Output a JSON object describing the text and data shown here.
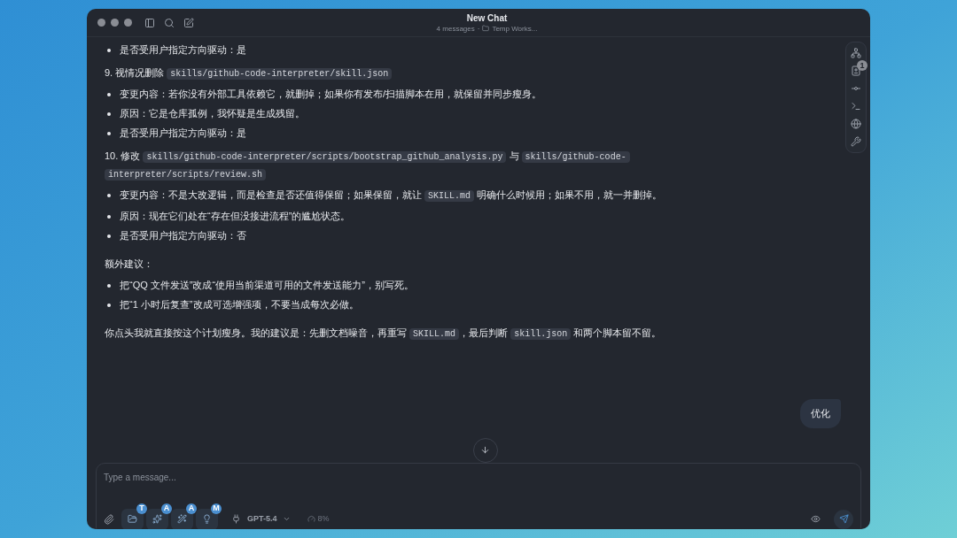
{
  "window": {
    "title": "New Chat",
    "message_count": "4 messages",
    "separator": "·",
    "workspace": "Temp Works..."
  },
  "messages": [
    {
      "kind": "bullet",
      "parts": [
        {
          "kind": "text",
          "text": "是否受用户指定方向驱动：是"
        }
      ]
    },
    {
      "kind": "heading",
      "parts": [
        {
          "kind": "text",
          "text": "9. 视情况删除 "
        },
        {
          "kind": "code",
          "text": "skills/github-code-interpreter/skill.json"
        }
      ]
    },
    {
      "kind": "bullet",
      "parts": [
        {
          "kind": "text",
          "text": "变更内容：若你没有外部工具依赖它，就删掉；如果你有发布/扫描脚本在用，就保留并同步瘦身。"
        }
      ]
    },
    {
      "kind": "bullet",
      "parts": [
        {
          "kind": "text",
          "text": "原因：它是仓库孤例，我怀疑是生成残留。"
        }
      ]
    },
    {
      "kind": "bullet",
      "parts": [
        {
          "kind": "text",
          "text": "是否受用户指定方向驱动：是"
        }
      ]
    },
    {
      "kind": "heading",
      "parts": [
        {
          "kind": "text",
          "text": "10. 修改 "
        },
        {
          "kind": "code",
          "text": "skills/github-code-interpreter/scripts/bootstrap_github_analysis.py"
        },
        {
          "kind": "text",
          "text": " 与 "
        },
        {
          "kind": "code",
          "text": "skills/github-code-interpreter/scripts/review.sh"
        }
      ]
    },
    {
      "kind": "bullet",
      "parts": [
        {
          "kind": "text",
          "text": "变更内容：不是大改逻辑，而是检查是否还值得保留；如果保留，就让 "
        },
        {
          "kind": "code",
          "text": "SKILL.md"
        },
        {
          "kind": "text",
          "text": " 明确什么时候用；如果不用，就一并删掉。"
        }
      ]
    },
    {
      "kind": "bullet",
      "parts": [
        {
          "kind": "text",
          "text": "原因：现在它们处在“存在但没接进流程”的尴尬状态。"
        }
      ]
    },
    {
      "kind": "bullet",
      "parts": [
        {
          "kind": "text",
          "text": "是否受用户指定方向驱动：否"
        }
      ]
    },
    {
      "kind": "paragraph",
      "parts": [
        {
          "kind": "text",
          "text": "额外建议："
        }
      ]
    },
    {
      "kind": "bullet",
      "parts": [
        {
          "kind": "text",
          "text": "把“QQ 文件发送”改成“使用当前渠道可用的文件发送能力”，别写死。"
        }
      ]
    },
    {
      "kind": "bullet",
      "parts": [
        {
          "kind": "text",
          "text": "把“1 小时后复查”改成可选增强项，不要当成每次必做。"
        }
      ]
    },
    {
      "kind": "paragraph",
      "parts": [
        {
          "kind": "text",
          "text": "你点头我就直接按这个计划瘦身。我的建议是：先删文档噪音，再重写 "
        },
        {
          "kind": "code",
          "text": "SKILL.md"
        },
        {
          "kind": "text",
          "text": "，最后判断 "
        },
        {
          "kind": "code",
          "text": "skill.json"
        },
        {
          "kind": "text",
          "text": " 和两个脚本留不留。"
        }
      ]
    }
  ],
  "user_message": "优化",
  "rail": [
    {
      "kind": "tree"
    },
    {
      "kind": "diff",
      "badge": "1"
    },
    {
      "kind": "commit"
    },
    {
      "kind": "terminal"
    },
    {
      "kind": "globe"
    },
    {
      "kind": "wrench"
    }
  ],
  "composer": {
    "placeholder": "Type a message...",
    "tools": [
      {
        "kind": "folder",
        "badge": "T"
      },
      {
        "kind": "sparkles",
        "badge": "A"
      },
      {
        "kind": "wand",
        "badge": "A"
      },
      {
        "kind": "bulb",
        "badge": "M"
      }
    ],
    "model": "GPT-5.4",
    "context": "8%"
  }
}
